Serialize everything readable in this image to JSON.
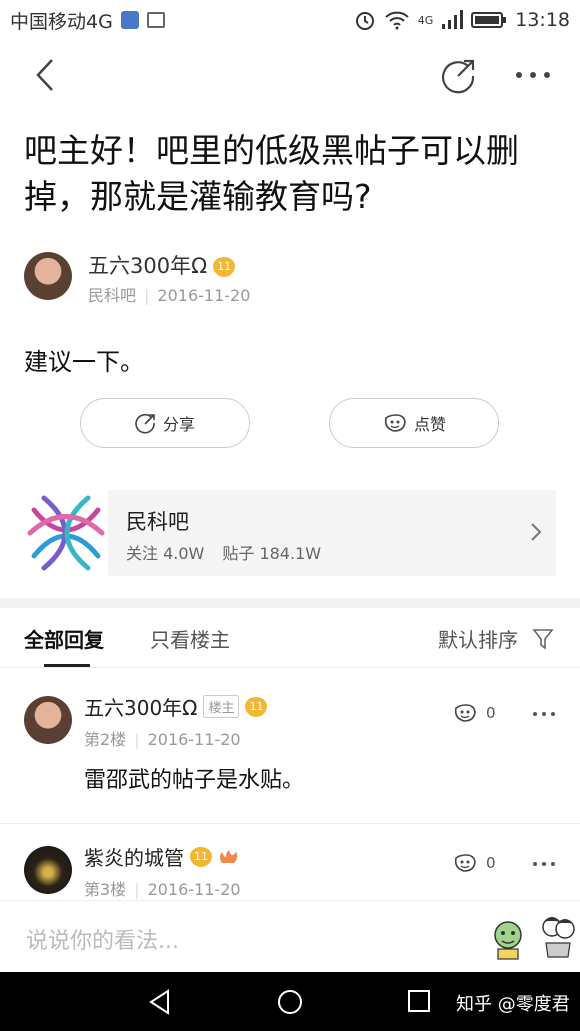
{
  "status_bar": {
    "carrier": "中国移动4G",
    "network": "4G",
    "time": "13:18"
  },
  "post": {
    "title": "吧主好！吧里的低级黑帖子可以删掉，那就是灌输教育吗?",
    "author": {
      "name": "五六300年Ω",
      "level": "11",
      "forum": "民科吧",
      "date": "2016-11-20"
    },
    "content": "建议一下。",
    "share_label": "分享",
    "like_label": "点赞"
  },
  "forum_card": {
    "name": "民科吧",
    "followers": "关注 4.0W",
    "posts": "贴子 184.1W"
  },
  "tabs": {
    "all": "全部回复",
    "host_only": "只看楼主",
    "sort": "默认排序"
  },
  "replies": [
    {
      "name": "五六300年Ω",
      "host_tag": "楼主",
      "level": "11",
      "floor": "第2楼",
      "date": "2016-11-20",
      "text": "雷邵武的帖子是水贴。",
      "likes": "0"
    },
    {
      "name": "紫炎的城管",
      "level": "11",
      "floor": "第3楼",
      "date": "2016-11-20",
      "likes": "0"
    }
  ],
  "comment_bar": {
    "placeholder": "说说你的看法..."
  },
  "watermark": "知乎 @零度君",
  "colors": {
    "level_badge": "#f5b731",
    "card_bg": "#f5f5f5"
  }
}
